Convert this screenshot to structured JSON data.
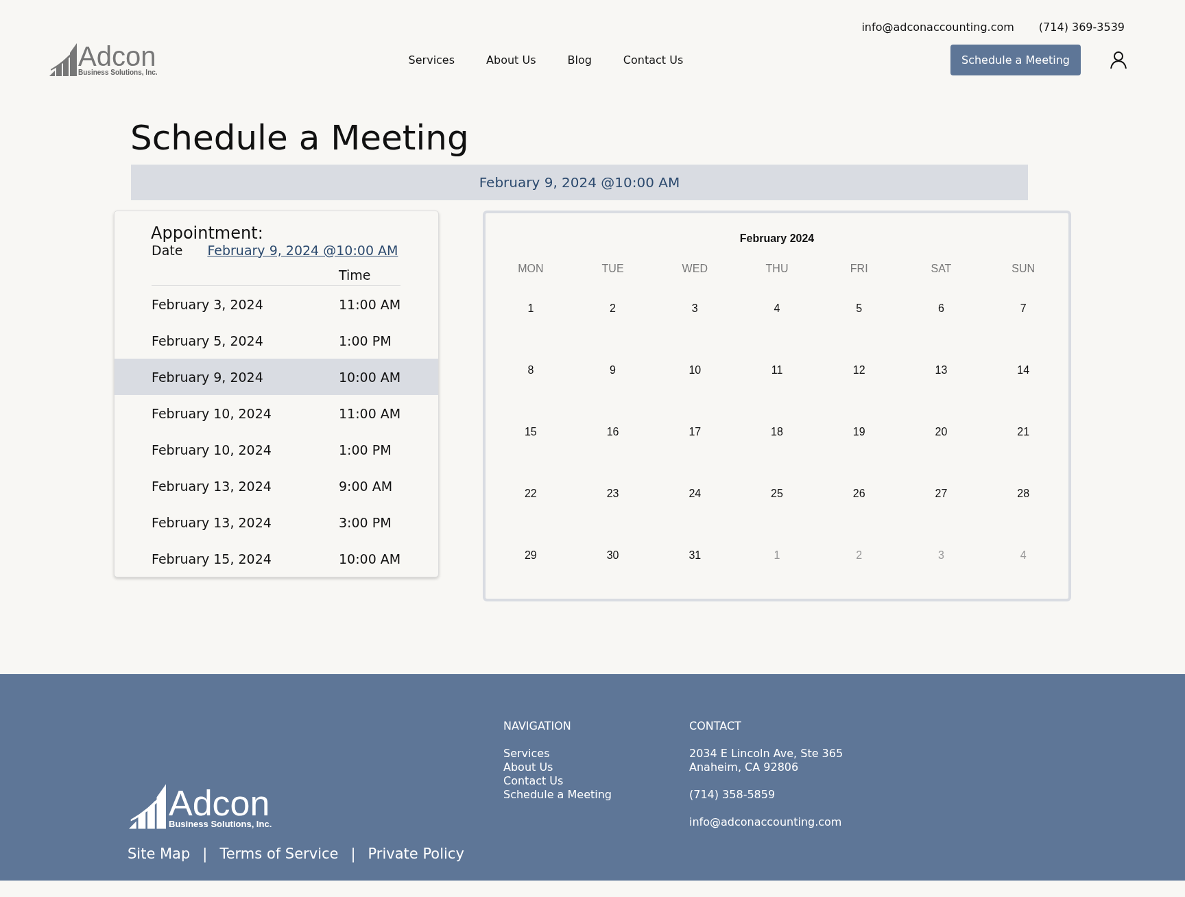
{
  "header": {
    "email": "info@adconaccounting.com",
    "phone": "(714) 369-3539",
    "logo": {
      "name": "Adcon",
      "tagline": "Business Solutions, Inc."
    },
    "nav": [
      "Services",
      "About Us",
      "Blog",
      "Contact Us"
    ],
    "cta": "Schedule a Meeting"
  },
  "page_title": "Schedule a Meeting",
  "selected_banner": "February 9, 2024 @10:00 AM",
  "appointment": {
    "heading": "Appointment:",
    "date_label": "Date",
    "date_link": "February 9, 2024 @10:00 AM",
    "time_heading": "Time",
    "slots": [
      {
        "date": "February 3, 2024",
        "time": "11:00 AM",
        "selected": false
      },
      {
        "date": "February 5, 2024",
        "time": "1:00 PM",
        "selected": false
      },
      {
        "date": "February 9, 2024",
        "time": "10:00 AM",
        "selected": true
      },
      {
        "date": "February 10, 2024",
        "time": "11:00 AM",
        "selected": false
      },
      {
        "date": "February 10, 2024",
        "time": "1:00 PM",
        "selected": false
      },
      {
        "date": "February 13, 2024",
        "time": "9:00 AM",
        "selected": false
      },
      {
        "date": "February 13, 2024",
        "time": "3:00 PM",
        "selected": false
      },
      {
        "date": "February 15, 2024",
        "time": "10:00 AM",
        "selected": false
      }
    ]
  },
  "calendar": {
    "month": "February 2024",
    "weekdays": [
      "MON",
      "TUE",
      "WED",
      "THU",
      "FRI",
      "SAT",
      "SUN"
    ],
    "weeks": [
      [
        {
          "day": "1",
          "muted": false
        },
        {
          "day": "2",
          "muted": false
        },
        {
          "day": "3",
          "muted": false
        },
        {
          "day": "4",
          "muted": false
        },
        {
          "day": "5",
          "muted": false
        },
        {
          "day": "6",
          "muted": false
        },
        {
          "day": "7",
          "muted": false
        }
      ],
      [
        {
          "day": "8",
          "muted": false
        },
        {
          "day": "9",
          "muted": false
        },
        {
          "day": "10",
          "muted": false
        },
        {
          "day": "11",
          "muted": false
        },
        {
          "day": "12",
          "muted": false
        },
        {
          "day": "13",
          "muted": false
        },
        {
          "day": "14",
          "muted": false
        }
      ],
      [
        {
          "day": "15",
          "muted": false
        },
        {
          "day": "16",
          "muted": false
        },
        {
          "day": "17",
          "muted": false
        },
        {
          "day": "18",
          "muted": false
        },
        {
          "day": "19",
          "muted": false
        },
        {
          "day": "20",
          "muted": false
        },
        {
          "day": "21",
          "muted": false
        }
      ],
      [
        {
          "day": "22",
          "muted": false
        },
        {
          "day": "23",
          "muted": false
        },
        {
          "day": "24",
          "muted": false
        },
        {
          "day": "25",
          "muted": false
        },
        {
          "day": "26",
          "muted": false
        },
        {
          "day": "27",
          "muted": false
        },
        {
          "day": "28",
          "muted": false
        }
      ],
      [
        {
          "day": "29",
          "muted": false
        },
        {
          "day": "30",
          "muted": false
        },
        {
          "day": "31",
          "muted": false
        },
        {
          "day": "1",
          "muted": true
        },
        {
          "day": "2",
          "muted": true
        },
        {
          "day": "3",
          "muted": true
        },
        {
          "day": "4",
          "muted": true
        }
      ]
    ]
  },
  "footer": {
    "logo": {
      "name": "Adcon",
      "tagline": "Business Solutions, Inc."
    },
    "navigation": {
      "heading": "NAVIGATION",
      "links": [
        "Services",
        "About Us",
        "Contact Us",
        "Schedule a Meeting"
      ]
    },
    "contact": {
      "heading": "CONTACT",
      "address": [
        "2034 E Lincoln Ave, Ste 365",
        "Anaheim, CA 92806"
      ],
      "phone": "(714) 358-5859",
      "email": "info@adconaccounting.com"
    },
    "bottom_links": [
      "Site Map",
      "Terms of Service",
      "Private Policy"
    ],
    "separator": "|"
  }
}
